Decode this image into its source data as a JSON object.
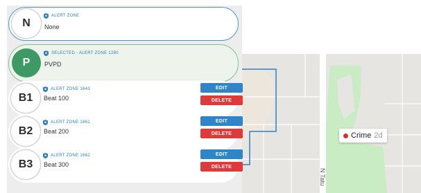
{
  "colors": {
    "accent_blue": "#2e86c9",
    "danger_red": "#df3a3a",
    "selected_green": "#3e9a64"
  },
  "zones": [
    {
      "badge": "N",
      "label": "ALERT ZONE",
      "name": "None",
      "state": "focused"
    },
    {
      "badge": "P",
      "label": "SELECTED - ALERT ZONE 1280",
      "name": "PVPD",
      "state": "selected"
    },
    {
      "badge": "B1",
      "label": "ALERT ZONE 1643",
      "name": "Beat 100",
      "edit": "EDIT",
      "delete": "DELETE"
    },
    {
      "badge": "B2",
      "label": "ALERT ZONE 1661",
      "name": "Beat 200",
      "edit": "EDIT",
      "delete": "DELETE"
    },
    {
      "badge": "B3",
      "label": "ALERT ZONE 1662",
      "name": "Beat 300",
      "edit": "EDIT",
      "delete": "DELETE"
    }
  ],
  "map": {
    "marker": {
      "label": "Crime",
      "age": "2d",
      "icon": "red-dot-icon"
    },
    "street": "N Tatu"
  }
}
